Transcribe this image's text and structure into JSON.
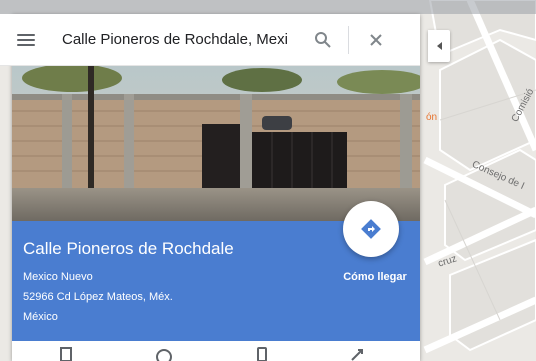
{
  "search": {
    "value": "Calle Pioneros de Rochdale, Mexi"
  },
  "place": {
    "title": "Calle Pioneros de Rochdale",
    "address_lines": [
      "Mexico Nuevo",
      "52966 Cd López Mateos, Méx.",
      "México"
    ]
  },
  "directions": {
    "label": "Cómo llegar"
  },
  "map_labels": {
    "street_consejo": "Consejo de I",
    "street_comisio": "Comisió",
    "street_cruz": "cruz",
    "partial_orange": "ón"
  },
  "colors": {
    "accent": "#4a7dd0",
    "fab_icon": "#4a7dd0",
    "map_bg": "#ebe9e5"
  },
  "icons": {
    "menu": "menu-icon",
    "search": "search-icon",
    "close": "close-icon",
    "directions": "directions-icon",
    "collapse": "chevron-left-icon"
  }
}
